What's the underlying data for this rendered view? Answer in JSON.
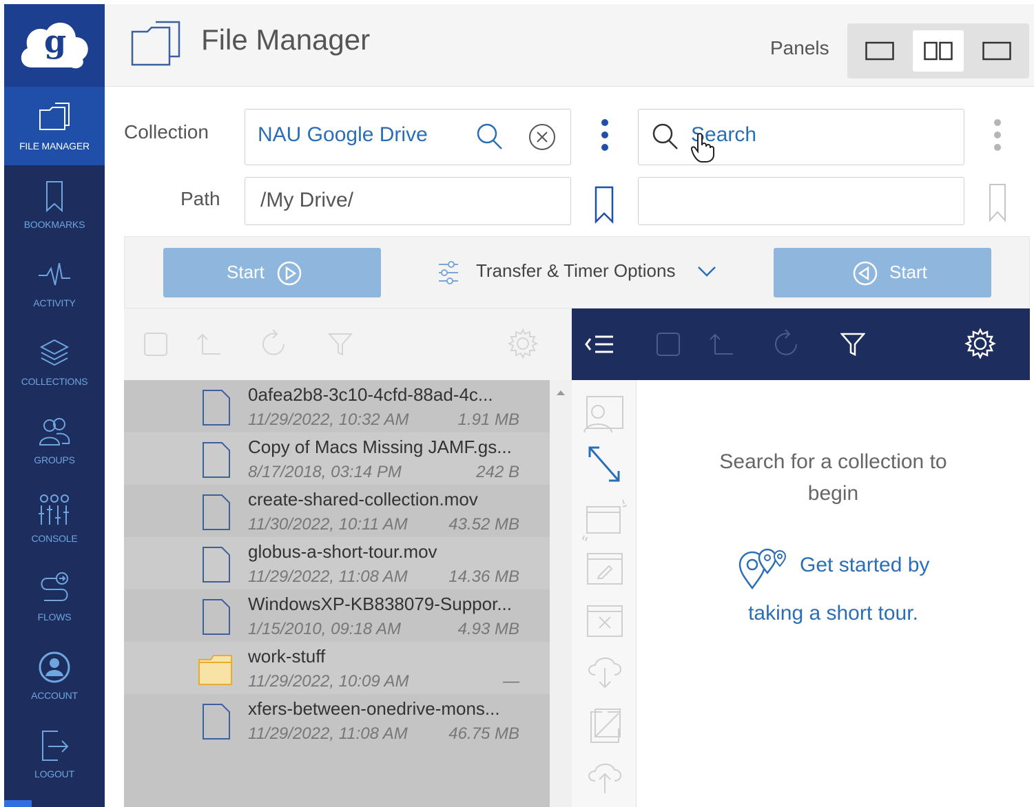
{
  "sidebar": {
    "items": [
      {
        "label": "FILE MANAGER",
        "icon": "folder-icon",
        "active": true
      },
      {
        "label": "BOOKMARKS",
        "icon": "bookmark-icon"
      },
      {
        "label": "ACTIVITY",
        "icon": "activity-icon"
      },
      {
        "label": "COLLECTIONS",
        "icon": "layers-icon"
      },
      {
        "label": "GROUPS",
        "icon": "groups-icon"
      },
      {
        "label": "CONSOLE",
        "icon": "console-icon"
      },
      {
        "label": "FLOWS",
        "icon": "flows-icon"
      },
      {
        "label": "ACCOUNT",
        "icon": "account-icon"
      },
      {
        "label": "LOGOUT",
        "icon": "logout-icon"
      }
    ]
  },
  "header": {
    "title": "File Manager",
    "panels_label": "Panels"
  },
  "left": {
    "collection_label": "Collection",
    "collection_value": "NAU Google Drive",
    "path_label": "Path",
    "path_value": "/My Drive/",
    "start_label": "Start",
    "files": [
      {
        "name": "0afea2b8-3c10-4cfd-88ad-4c...",
        "date": "11/29/2022, 10:32 AM",
        "size": "1.91 MB",
        "type": "file"
      },
      {
        "name": "Copy of Macs Missing JAMF.gs...",
        "date": "8/17/2018, 03:14 PM",
        "size": "242 B",
        "type": "file"
      },
      {
        "name": "create-shared-collection.mov",
        "date": "11/30/2022, 10:11 AM",
        "size": "43.52 MB",
        "type": "file"
      },
      {
        "name": "globus-a-short-tour.mov",
        "date": "11/29/2022, 11:08 AM",
        "size": "14.36 MB",
        "type": "file"
      },
      {
        "name": "WindowsXP-KB838079-Suppor...",
        "date": "1/15/2010, 09:18 AM",
        "size": "4.93 MB",
        "type": "file"
      },
      {
        "name": "work-stuff",
        "date": "11/29/2022, 10:09 AM",
        "size": "—",
        "type": "folder"
      },
      {
        "name": "xfers-between-onedrive-mons...",
        "date": "11/29/2022, 11:08 AM",
        "size": "46.75 MB",
        "type": "file"
      }
    ]
  },
  "transfer": {
    "options_label": "Transfer & Timer Options"
  },
  "right": {
    "search_placeholder": "Search",
    "start_label": "Start",
    "empty_message": "Search for a collection to begin",
    "tour_line1": "Get started by",
    "tour_line2": "taking a short tour."
  },
  "colors": {
    "sidebar_bg": "#1c2d5e",
    "sidebar_active": "#1f4fa8",
    "accent_blue": "#2a6eb6",
    "start_button": "#8fb7dd",
    "folder": "#f0c24b"
  }
}
